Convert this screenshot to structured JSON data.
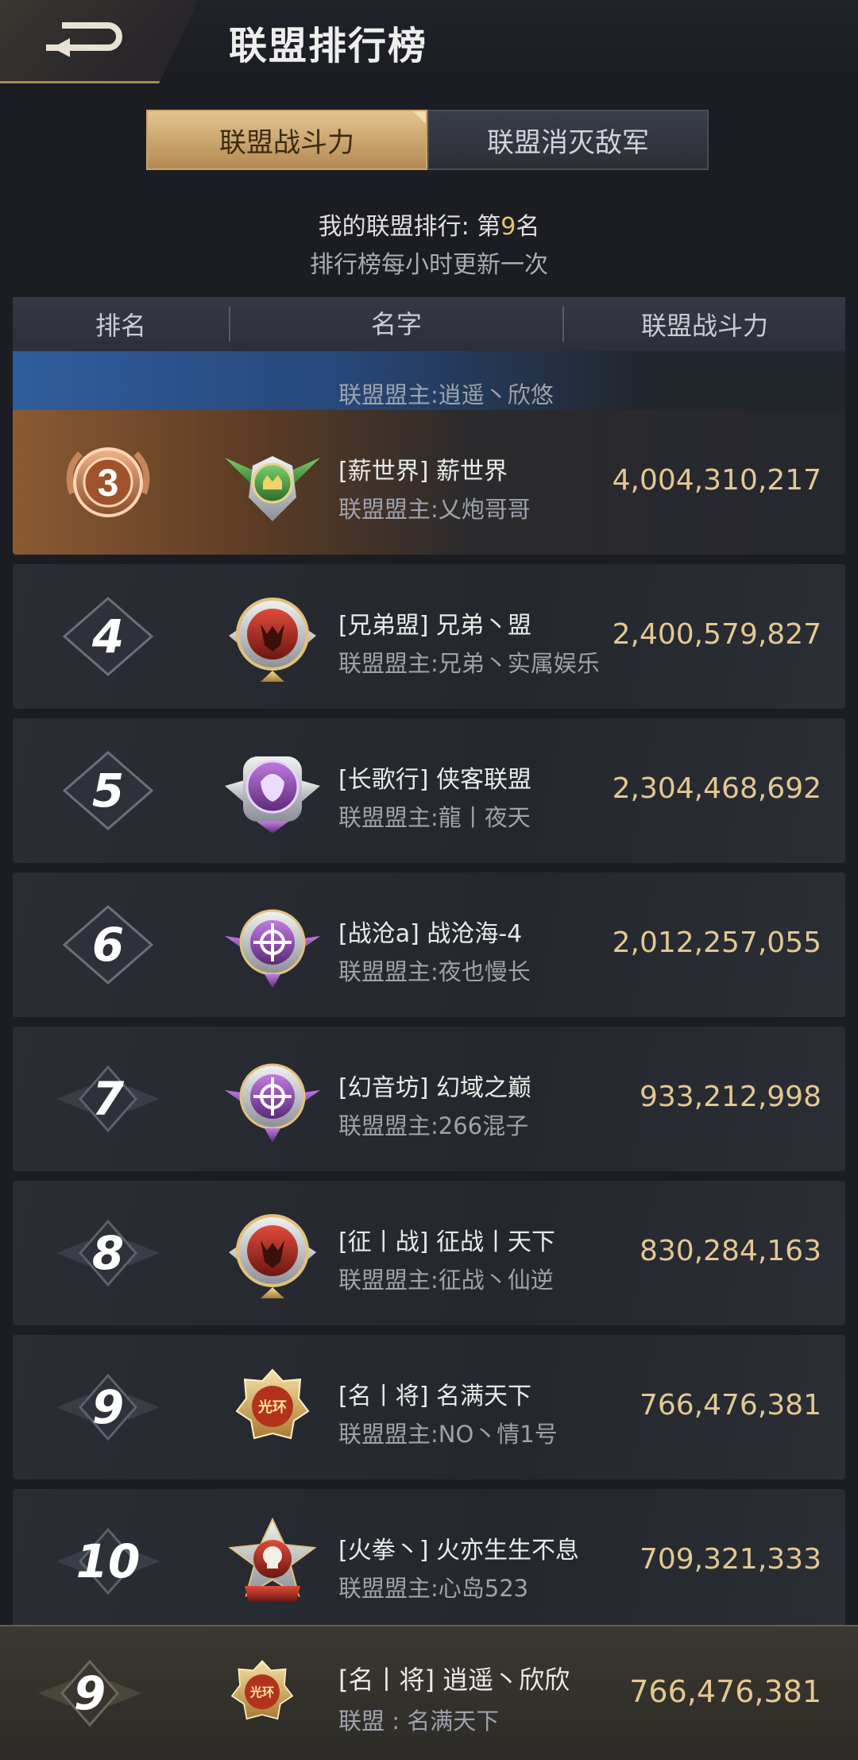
{
  "header": {
    "title": "联盟排行榜",
    "back_icon": "back-arrow-icon"
  },
  "tabs": [
    {
      "label": "联盟战斗力",
      "active": true
    },
    {
      "label": "联盟消灭敌军",
      "active": false
    }
  ],
  "rank_info": {
    "prefix": "我的联盟排行: 第",
    "rank": "9",
    "suffix": "名",
    "update_note": "排行榜每小时更新一次"
  },
  "columns": {
    "rank": "排名",
    "name": "名字",
    "power": "联盟战斗力"
  },
  "rows": [
    {
      "rank": "3",
      "name": "[薪世界] 薪世界",
      "leader": "联盟盟主:乂炮哥哥",
      "power": "4,004,310,217",
      "emblem": "green-wing-emblem"
    },
    {
      "rank": "4",
      "name": "[兄弟盟] 兄弟丶盟",
      "leader": "联盟盟主:兄弟丶实属娱乐",
      "power": "2,400,579,827",
      "emblem": "red-wolf-emblem"
    },
    {
      "rank": "5",
      "name": "[长歌行] 侠客联盟",
      "leader": "联盟盟主:龍丨夜天",
      "power": "2,304,468,692",
      "emblem": "purple-lion-emblem"
    },
    {
      "rank": "6",
      "name": "[战沧a] 战沧海-4",
      "leader": "联盟盟主:夜也慢长",
      "power": "2,012,257,055",
      "emblem": "purple-crosshair-emblem"
    },
    {
      "rank": "7",
      "name": "[幻音坊] 幻域之巅",
      "leader": "联盟盟主:266混子",
      "power": "933,212,998",
      "emblem": "purple-crosshair-emblem"
    },
    {
      "rank": "8",
      "name": "[征丨战] 征战丨天下",
      "leader": "联盟盟主:征战丶仙逆",
      "power": "830,284,163",
      "emblem": "red-wolf-emblem"
    },
    {
      "rank": "9",
      "name": "[名丨将] 名满天下",
      "leader": "联盟盟主:NO丶情1号",
      "power": "766,476,381",
      "emblem": "gold-halo-emblem",
      "emblem_text": "光环"
    },
    {
      "rank": "10",
      "name": "[火拳丶] 火亦生生不息",
      "leader": "联盟盟主:心岛523",
      "power": "709,321,333",
      "emblem": "skull-star-emblem"
    }
  ],
  "partial_row": {
    "leader": "联盟盟主:逍遥丶欣悠"
  },
  "self_row": {
    "rank": "9",
    "name": "[名丨将] 逍遥丶欣欣",
    "alliance": "联盟 : 名满天下",
    "power": "766,476,381",
    "emblem": "gold-halo-emblem",
    "emblem_text": "光环"
  },
  "colors": {
    "gold": "#e3c891",
    "tab_active": "#d4b27a",
    "bronze": "#8b5a33",
    "blue": "#2f5d9d"
  }
}
